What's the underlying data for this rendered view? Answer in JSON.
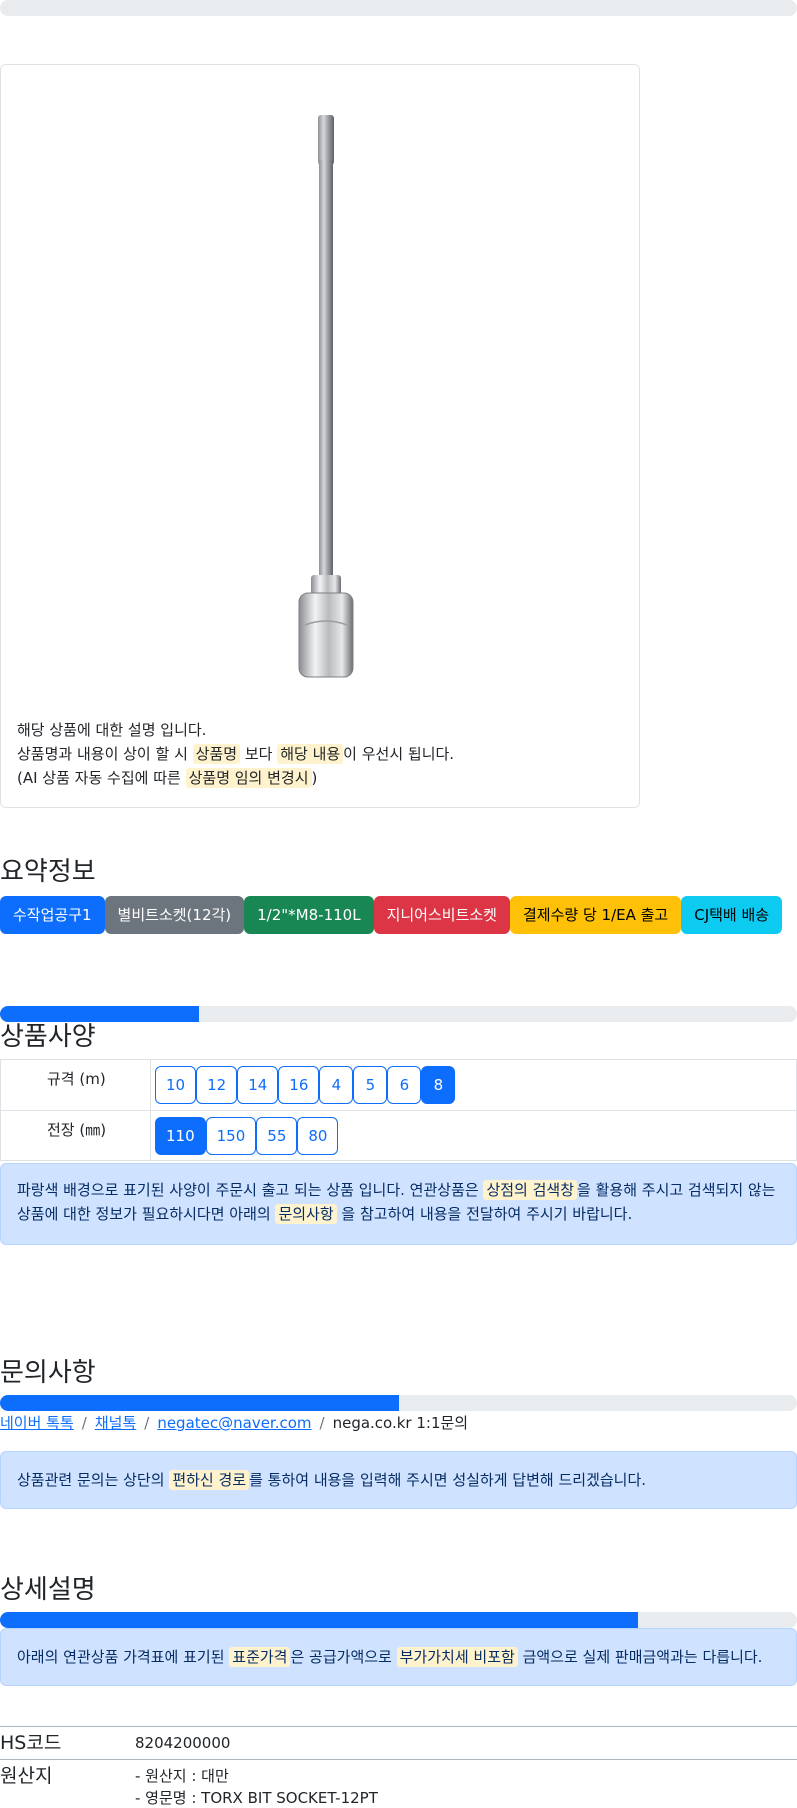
{
  "top_progress": {
    "fraction": 0.0
  },
  "card": {
    "image_alt": "1/2\" 별비트소켓 M8 110L",
    "line1": "해당 상품에 대한 설명 입니다.",
    "line2_a": "상품명과 내용이 상이 할 시 ",
    "line2_hl1": "상품명",
    "line2_b": " 보다 ",
    "line2_hl2": "해당 내용",
    "line2_c": "이 우선시 됩니다.",
    "line3_a": "(AI 상품 자동 수집에 따른 ",
    "line3_hl": "상품명 임의 변경시",
    "line3_b": ")"
  },
  "summary": {
    "title": "요약정보",
    "badges": [
      {
        "label": "수작업공구1",
        "color": "#0d6efd",
        "text_color": "#ffffff"
      },
      {
        "label": "별비트소켓(12각)",
        "color": "#6c757d",
        "text_color": "#ffffff"
      },
      {
        "label": "1/2\"*M8-110L",
        "color": "#198754",
        "text_color": "#ffffff"
      },
      {
        "label": "지니어스비트소켓",
        "color": "#dc3545",
        "text_color": "#ffffff"
      },
      {
        "label": "결제수량 당 1/EA 출고",
        "color": "#ffc107",
        "text_color": "#000000"
      },
      {
        "label": "CJ택배 배송",
        "color": "#0dcaf0",
        "text_color": "#000000"
      }
    ]
  },
  "spec": {
    "progress_fraction": 0.25,
    "title": "상품사양",
    "rows": [
      {
        "label": "규격 (m)",
        "options": [
          "10",
          "12",
          "14",
          "16",
          "4",
          "5",
          "6",
          "8"
        ],
        "selected": "8"
      },
      {
        "label": "전장 (㎜)",
        "options": [
          "110",
          "150",
          "55",
          "80"
        ],
        "selected": "110"
      }
    ],
    "note_a": "파랑색 배경으로 표기된 사양이 주문시 출고 되는 상품 입니다. 연관상품은 ",
    "note_hl1": "상점의 검색창",
    "note_b": "을 활용해 주시고 검색되지 않는 상품에 대한 정보가 필요하시다면 아래의 ",
    "note_hl2": "문의사항",
    "note_c": " 을 참고하여 내용을 전달하여 주시기 바랍니다."
  },
  "inquiry": {
    "title": "문의사항",
    "progress_fraction": 0.5,
    "links": [
      "네이버 톡톡",
      "채널톡",
      "negatec@naver.com"
    ],
    "plain": "nega.co.kr 1:1문의",
    "separator": "/",
    "note_a": "상품관련 문의는 상단의 ",
    "note_hl": "편하신 경로",
    "note_b": "를 통하여 내용을 입력해 주시면 성실하게 답변해 드리겠습니다."
  },
  "detail": {
    "title": "상세설명",
    "progress_fraction": 0.8,
    "note_a": "아래의 연관상품 가격표에 표기된 ",
    "note_hl1": "표준가격",
    "note_b": "은 공급가액으로 ",
    "note_hl2": "부가가치세 비포함",
    "note_c": " 금액으로 실제 판매금액과는 다릅니다."
  },
  "info": {
    "hs_key": "HS코드",
    "hs_val": "8204200000",
    "origin_key": "원산지",
    "origin_line1": "- 원산지 : 대만",
    "origin_line2": "- 영문명 : TORX BIT SOCKET-12PT"
  }
}
